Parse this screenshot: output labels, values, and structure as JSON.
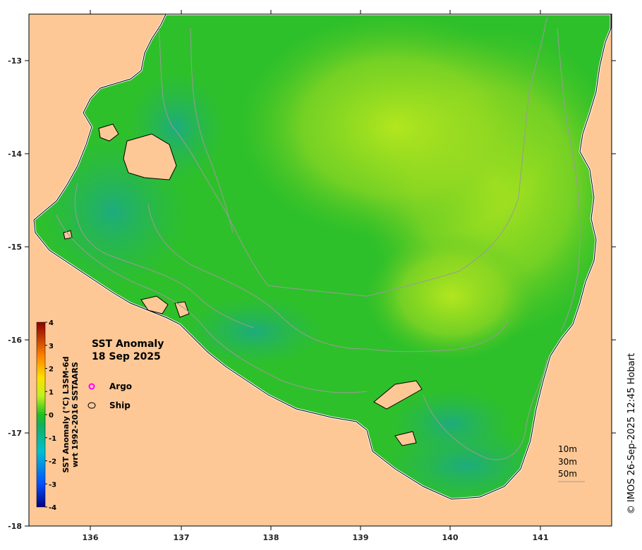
{
  "title": {
    "line1": "SST Anomaly",
    "line2": "18 Sep 2025"
  },
  "legend": {
    "argo": "Argo",
    "ship": "Ship",
    "argo_color": "#ff00ff"
  },
  "colorbar": {
    "title_line1": "SST Anomaly (°C) L3SM-6d",
    "title_line2": "wrt 1992-2016 SSTAARS",
    "ticks": [
      "-4",
      "-3",
      "-2",
      "-1",
      "0",
      "1",
      "2",
      "3",
      "4"
    ],
    "min": -4,
    "max": 4
  },
  "axes": {
    "lon_ticks": [
      "136",
      "137",
      "138",
      "139",
      "140",
      "141"
    ],
    "lat_ticks": [
      "-13",
      "-14",
      "-15",
      "-16",
      "-17",
      "-18"
    ],
    "lon_range": [
      135.3,
      141.8
    ],
    "lat_range": [
      -12.5,
      -18.0
    ]
  },
  "depth_legend": {
    "d1": "10m",
    "d2": "30m",
    "d3": "50m"
  },
  "credit": "© IMOS 26-Sep-2025 12:45 Hobart",
  "colors": {
    "land": "#fdc896",
    "sst_green": "#2ec02a",
    "sst_light": "#a6e020",
    "sst_cyan": "#1fb08a",
    "contour": "#9a9a9a"
  }
}
